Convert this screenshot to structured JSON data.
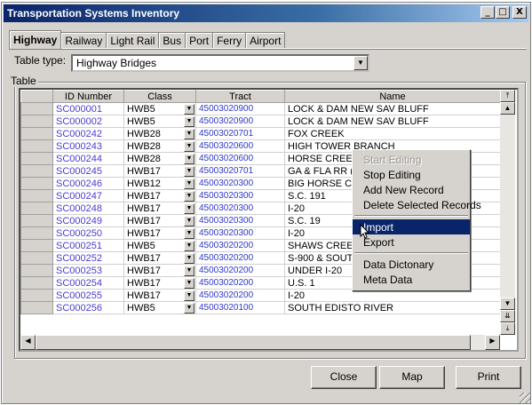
{
  "window": {
    "title": "Transportation Systems Inventory"
  },
  "titlebar_buttons": {
    "minimize": "_",
    "maximize": "□",
    "close": "X"
  },
  "tabs": [
    "Highway",
    "Railway",
    "Light Rail",
    "Bus",
    "Port",
    "Ferry",
    "Airport"
  ],
  "active_tab": "Highway",
  "table_type": {
    "label": "Table type:",
    "value": "Highway Bridges"
  },
  "group": {
    "label": "Table"
  },
  "columns": [
    "ID Number",
    "Class",
    "Tract",
    "Name"
  ],
  "rows": [
    {
      "id": "SC000001",
      "class": "HWB5",
      "tract": "45003020900",
      "name": "LOCK & DAM NEW SAV BLUFF"
    },
    {
      "id": "SC000002",
      "class": "HWB5",
      "tract": "45003020900",
      "name": "LOCK & DAM NEW SAV BLUFF"
    },
    {
      "id": "SC000242",
      "class": "HWB28",
      "tract": "45003020701",
      "name": "FOX CREEK"
    },
    {
      "id": "SC000243",
      "class": "HWB28",
      "tract": "45003020600",
      "name": "HIGH TOWER BRANCH"
    },
    {
      "id": "SC000244",
      "class": "HWB28",
      "tract": "45003020600",
      "name": "HORSE CREEK"
    },
    {
      "id": "SC000245",
      "class": "HWB17",
      "tract": "45003020701",
      "name": "GA & FLA RR (N"
    },
    {
      "id": "SC000246",
      "class": "HWB12",
      "tract": "45003020300",
      "name": "BIG HORSE CREEK"
    },
    {
      "id": "SC000247",
      "class": "HWB17",
      "tract": "45003020300",
      "name": "S.C. 191"
    },
    {
      "id": "SC000248",
      "class": "HWB17",
      "tract": "45003020300",
      "name": "I-20"
    },
    {
      "id": "SC000249",
      "class": "HWB17",
      "tract": "45003020300",
      "name": "S.C. 19"
    },
    {
      "id": "SC000250",
      "class": "HWB17",
      "tract": "45003020300",
      "name": "I-20"
    },
    {
      "id": "SC000251",
      "class": "HWB5",
      "tract": "45003020200",
      "name": "SHAWS CREEK"
    },
    {
      "id": "SC000252",
      "class": "HWB17",
      "tract": "45003020200",
      "name": "S-900 & SOUTH"
    },
    {
      "id": "SC000253",
      "class": "HWB17",
      "tract": "45003020200",
      "name": "UNDER I-20"
    },
    {
      "id": "SC000254",
      "class": "HWB17",
      "tract": "45003020200",
      "name": "U.S. 1"
    },
    {
      "id": "SC000255",
      "class": "HWB17",
      "tract": "45003020200",
      "name": "I-20"
    },
    {
      "id": "SC000256",
      "class": "HWB5",
      "tract": "45003020100",
      "name": "SOUTH EDISTO RIVER"
    }
  ],
  "context_menu": {
    "items": [
      {
        "label": "Start Editing",
        "disabled": true
      },
      {
        "label": "Stop Editing"
      },
      {
        "label": "Add New Record"
      },
      {
        "label": "Delete Selected Records"
      },
      {
        "label": "Import",
        "highlighted": true
      },
      {
        "label": "Export"
      },
      {
        "label": "Data Dictonary"
      },
      {
        "label": "Meta Data"
      }
    ]
  },
  "buttons": {
    "close": "Close",
    "map": "Map",
    "print": "Print"
  },
  "colors": {
    "titlebar": "#0a246a",
    "id_text": "#4a3bd0",
    "tract_text": "#2e37c9",
    "highlight": "#0a246a"
  }
}
